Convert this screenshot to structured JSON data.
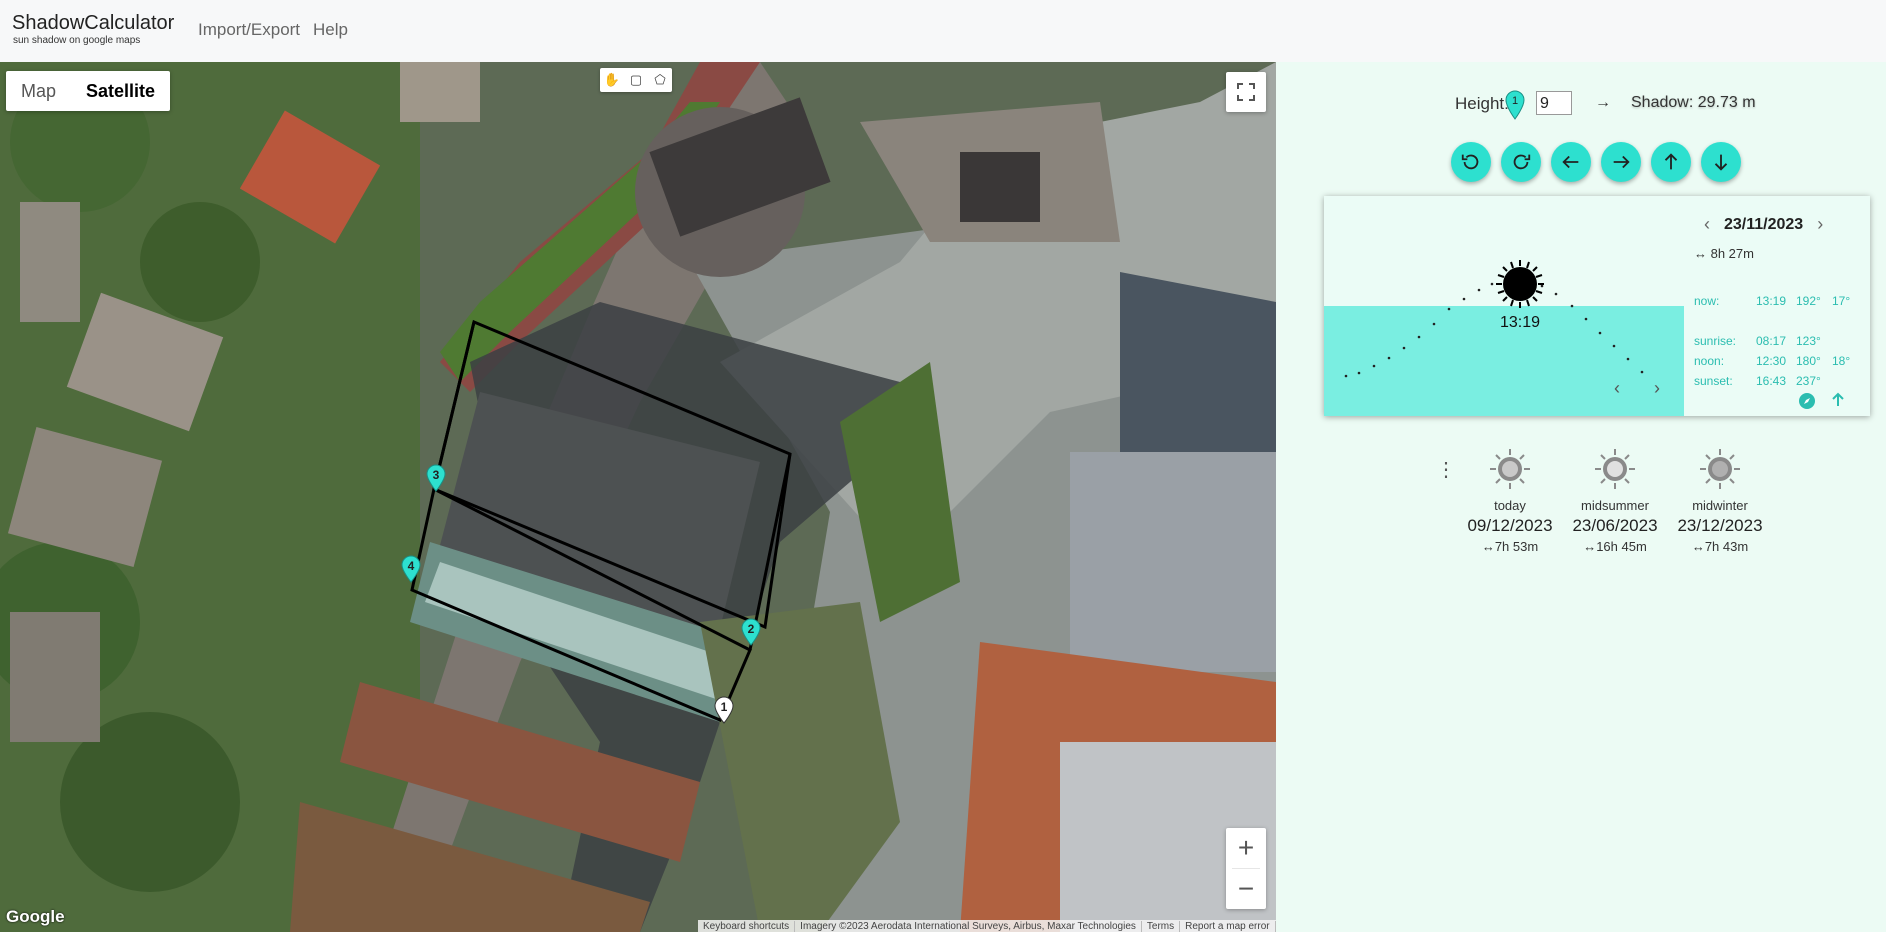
{
  "header": {
    "title": "ShadowCalculator",
    "subtitle": "sun shadow on google maps",
    "nav": [
      "Import/Export",
      "Help"
    ]
  },
  "map": {
    "type_buttons": [
      "Map",
      "Satellite"
    ],
    "active_type": "Satellite",
    "tools": [
      "hand-icon",
      "rectangle-icon",
      "polygon-icon"
    ],
    "markers": [
      "1",
      "2",
      "3",
      "4"
    ],
    "zoom_in": "+",
    "zoom_out": "−",
    "logo": "Google",
    "attribution": [
      "Keyboard shortcuts",
      "Imagery ©2023 Aerodata International Surveys, Airbus, Maxar Technologies",
      "Terms",
      "Report a map error"
    ]
  },
  "height": {
    "label": "Height:",
    "marker": "1",
    "value": "9",
    "arrow": "→",
    "shadow": "Shadow: 29.73 m"
  },
  "controls": [
    "rotate-ccw-icon",
    "rotate-cw-icon",
    "arrow-left-icon",
    "arrow-right-icon",
    "arrow-up-icon",
    "arrow-down-icon"
  ],
  "sun": {
    "date": "23/11/2023",
    "daylength": "↔ 8h 27m",
    "current_time": "13:19",
    "rows": [
      {
        "label": "now:",
        "time": "13:19",
        "azimuth": "192°",
        "elevation": "17°"
      },
      {
        "label": "sunrise:",
        "time": "08:17",
        "azimuth": "123°",
        "elevation": ""
      },
      {
        "label": "noon:",
        "time": "12:30",
        "azimuth": "180°",
        "elevation": "18°"
      },
      {
        "label": "sunset:",
        "time": "16:43",
        "azimuth": "237°",
        "elevation": ""
      }
    ],
    "small_prev": "‹",
    "small_next": "›"
  },
  "presets": [
    {
      "name": "today",
      "date": "09/12/2023",
      "length": "↔7h 53m"
    },
    {
      "name": "midsummer",
      "date": "23/06/2023",
      "length": "↔16h 45m"
    },
    {
      "name": "midwinter",
      "date": "23/12/2023",
      "length": "↔7h 43m"
    }
  ],
  "colors": {
    "accent": "#2de0cf",
    "ground": "#7aeee1",
    "panel_bg": "#ecfbf4",
    "accent_text": "#2bbdb0"
  }
}
